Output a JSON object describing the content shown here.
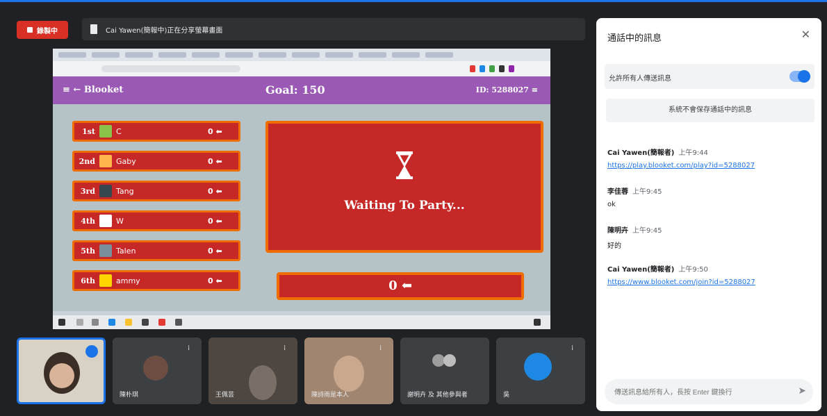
{
  "recording": {
    "label": "錄製中"
  },
  "presenter": {
    "text": "Cai Yawen(簡報中)正在分享螢幕畫面"
  },
  "blooket": {
    "logo": "≡ ← Blooket",
    "goal": "Goal: 150",
    "id": "ID: 5288027 ≡",
    "players": [
      {
        "rank": "1st",
        "name": "C",
        "score": "0 ⬅",
        "color": "#8bc34a"
      },
      {
        "rank": "2nd",
        "name": "Gaby",
        "score": "0 ⬅",
        "color": "#ffb74d"
      },
      {
        "rank": "3rd",
        "name": "Tang",
        "score": "0 ⬅",
        "color": "#37474f"
      },
      {
        "rank": "4th",
        "name": "W",
        "score": "0 ⬅",
        "color": "#ffffff"
      },
      {
        "rank": "5th",
        "name": "Talen",
        "score": "0 ⬅",
        "color": "#78909c"
      },
      {
        "rank": "6th",
        "name": "ammy",
        "score": "0 ⬅",
        "color": "#ffd600"
      }
    ],
    "waiting_text": "Waiting To Party...",
    "score_display": "0 ⬅"
  },
  "tiles": [
    {
      "name": ""
    },
    {
      "name": "陳朴琪"
    },
    {
      "name": "王佩芸"
    },
    {
      "name": "陳詩雨是本人"
    },
    {
      "name": "謝明卉 及 其他參與者"
    },
    {
      "name": "吳"
    }
  ],
  "chat": {
    "title": "通話中的訊息",
    "close": "✕",
    "toggle_label": "允許所有人傳送訊息",
    "notice": "系統不會保存通話中的訊息",
    "messages": [
      {
        "sender": "Cai Yawen(簡報者)",
        "time": "上午9:44",
        "body": "",
        "link": "https://play.blooket.com/play?id=5288027"
      },
      {
        "sender": "李佳蓉",
        "time": "上午9:45",
        "body": "ok",
        "link": ""
      },
      {
        "sender": "陳明卉",
        "time": "上午9:45",
        "body": "好的",
        "link": ""
      },
      {
        "sender": "Cai Yawen(簡報者)",
        "time": "上午9:50",
        "body": "",
        "link": "https://www.blooket.com/join?id=5288027"
      }
    ],
    "compose_placeholder": "傳送訊息給所有人，長按 Enter 鍵換行",
    "send_icon": "➤"
  }
}
